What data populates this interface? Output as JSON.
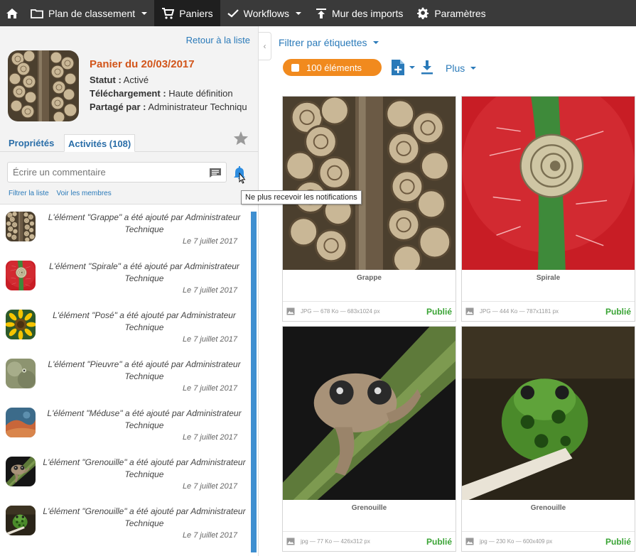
{
  "nav": {
    "items": [
      {
        "label": "Plan de classement",
        "dropdown": true
      },
      {
        "label": "Paniers",
        "active": true
      },
      {
        "label": "Workflows",
        "dropdown": true
      },
      {
        "label": "Mur des imports"
      },
      {
        "label": "Paramètres"
      }
    ]
  },
  "basket": {
    "back_label": "Retour à la liste",
    "title": "Panier du 20/03/2017",
    "status_label": "Statut :",
    "status_value": " Activé",
    "download_label": "Téléchargement :",
    "download_value": " Haute définition",
    "shared_label": "Partagé par :",
    "shared_value": " Administrateur Techniqu"
  },
  "tabs": {
    "properties": "Propriétés",
    "activities": "Activités (108)"
  },
  "comment": {
    "placeholder": "Écrire un commentaire"
  },
  "links": {
    "filter": "Filtrer la liste",
    "members": "Voir les membres"
  },
  "tooltip": "Ne plus recevoir les notifications",
  "activities": [
    {
      "text": "L'élément \"Grappe\" a été ajouté par Administrateur Technique",
      "date": "Le 7 juillet 2017",
      "thumb": "snails"
    },
    {
      "text": "L'élément \"Spirale\" a été ajouté par Administrateur Technique",
      "date": "Le 7 juillet 2017",
      "thumb": "spiral"
    },
    {
      "text": "L'élément \"Posé\" a été ajouté par Administrateur Technique",
      "date": "Le 7 juillet 2017",
      "thumb": "sunflower"
    },
    {
      "text": "L'élément \"Pieuvre\" a été ajouté par Administrateur Technique",
      "date": "Le 7 juillet 2017",
      "thumb": "octopus"
    },
    {
      "text": "L'élément \"Méduse\" a été ajouté par Administrateur Technique",
      "date": "Le 7 juillet 2017",
      "thumb": "jellyfish"
    },
    {
      "text": "L'élément \"Grenouille\" a été ajouté par Administrateur Technique",
      "date": "Le 7 juillet 2017",
      "thumb": "frog-brown"
    },
    {
      "text": "L'élément \"Grenouille\" a été ajouté par Administrateur Technique",
      "date": "Le 7 juillet 2017",
      "thumb": "frog-green"
    }
  ],
  "toolbar": {
    "filter_tags": "Filtrer par étiquettes",
    "count": "100 éléments",
    "more": "Plus"
  },
  "cards": [
    {
      "caption": "Grappe",
      "info": "JPG — 678 Ko — 683x1024 px",
      "status": "Publié",
      "image": "snails"
    },
    {
      "caption": "Spirale",
      "info": "JPG — 444 Ko — 787x1181 px",
      "status": "Publié",
      "image": "spiral"
    },
    {
      "caption": "Grenouille",
      "info": "jpg — 77 Ko — 426x312 px",
      "status": "Publié",
      "image": "frog-brown"
    },
    {
      "caption": "Grenouille",
      "info": "jpg — 230 Ko — 600x409 px",
      "status": "Publié",
      "image": "frog-green"
    }
  ],
  "colors": {
    "nav_bg": "#3a3a3a",
    "accent_orange": "#f18a1e",
    "title_orange": "#d2551a",
    "link_blue": "#2a7ab9",
    "published_green": "#3aa435"
  }
}
